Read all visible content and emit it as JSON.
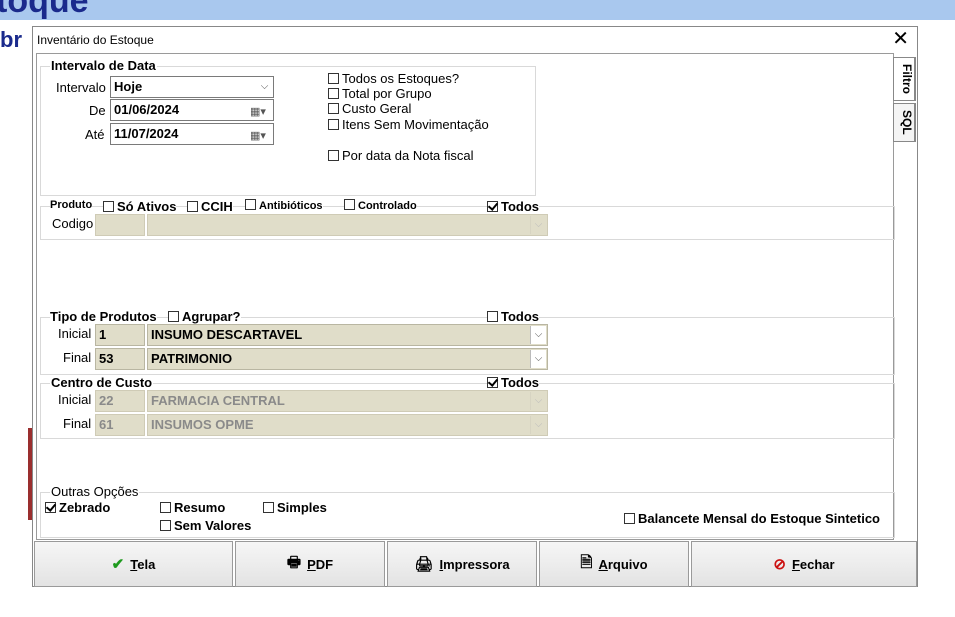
{
  "background": {
    "title": "toque",
    "side_text": "br"
  },
  "dialog": {
    "title": "Inventário do Estoque",
    "close_glyph": "✕"
  },
  "tabs": [
    {
      "label": "Filtro"
    },
    {
      "label": "SQL"
    }
  ],
  "intervalo": {
    "group_label": "Intervalo de Data",
    "intervalo_label": "Intervalo",
    "intervalo_value": "Hoje",
    "de_label": "De",
    "de_value": "01/06/2024",
    "ate_label": "Até",
    "ate_value": "11/07/2024",
    "options": [
      {
        "label": "Todos os Estoques?",
        "checked": false
      },
      {
        "label": "Total por Grupo",
        "checked": false
      },
      {
        "label": "Custo Geral",
        "checked": false
      },
      {
        "label": "Itens Sem Movimentação",
        "checked": false
      },
      {
        "label": "Por data da Nota fiscal",
        "checked": false
      }
    ]
  },
  "produto": {
    "group_label": "Produto",
    "so_ativos": "Só Ativos",
    "ccih": "CCIH",
    "antibioticos": "Antibióticos",
    "controlado": "Controlado",
    "todos": "Todos",
    "todos_checked": true,
    "codigo_label": "Codigo",
    "codigo_value": "",
    "descricao_value": ""
  },
  "tipo_produtos": {
    "group_label": "Tipo de Produtos",
    "agrupar": "Agrupar?",
    "todos": "Todos",
    "todos_checked": false,
    "inicial_label": "Inicial",
    "inicial_code": "1",
    "inicial_desc": "INSUMO DESCARTAVEL",
    "final_label": "Final",
    "final_code": "53",
    "final_desc": "PATRIMONIO"
  },
  "centro_custo": {
    "group_label": "Centro de Custo",
    "todos": "Todos",
    "todos_checked": true,
    "inicial_label": "Inicial",
    "inicial_code": "22",
    "inicial_desc": "FARMACIA CENTRAL",
    "final_label": "Final",
    "final_code": "61",
    "final_desc": "INSUMOS OPME"
  },
  "outras": {
    "group_label": "Outras Opções",
    "zebrado": "Zebrado",
    "zebrado_checked": true,
    "resumo": "Resumo",
    "simples": "Simples",
    "sem_valores": "Sem Valores",
    "balancete": "Balancete Mensal do Estoque Sintetico"
  },
  "buttons": [
    {
      "label": "Tela",
      "icon": "check-icon",
      "glyph": "✔",
      "color": "#1e9a1e"
    },
    {
      "label": "PDF",
      "icon": "pdf-icon",
      "glyph": "🖶",
      "color": "#333333"
    },
    {
      "label": "Impressora",
      "icon": "printer-icon",
      "glyph": "🖨",
      "color": "#333333"
    },
    {
      "label": "Arquivo",
      "icon": "file-icon",
      "glyph": "🗎",
      "color": "#333333"
    },
    {
      "label": "Fechar",
      "icon": "cancel-icon",
      "glyph": "⊘",
      "color": "#cc1111"
    }
  ],
  "icons": {
    "calendar": "calendar-icon",
    "dropdown": "chevron-down-icon"
  }
}
